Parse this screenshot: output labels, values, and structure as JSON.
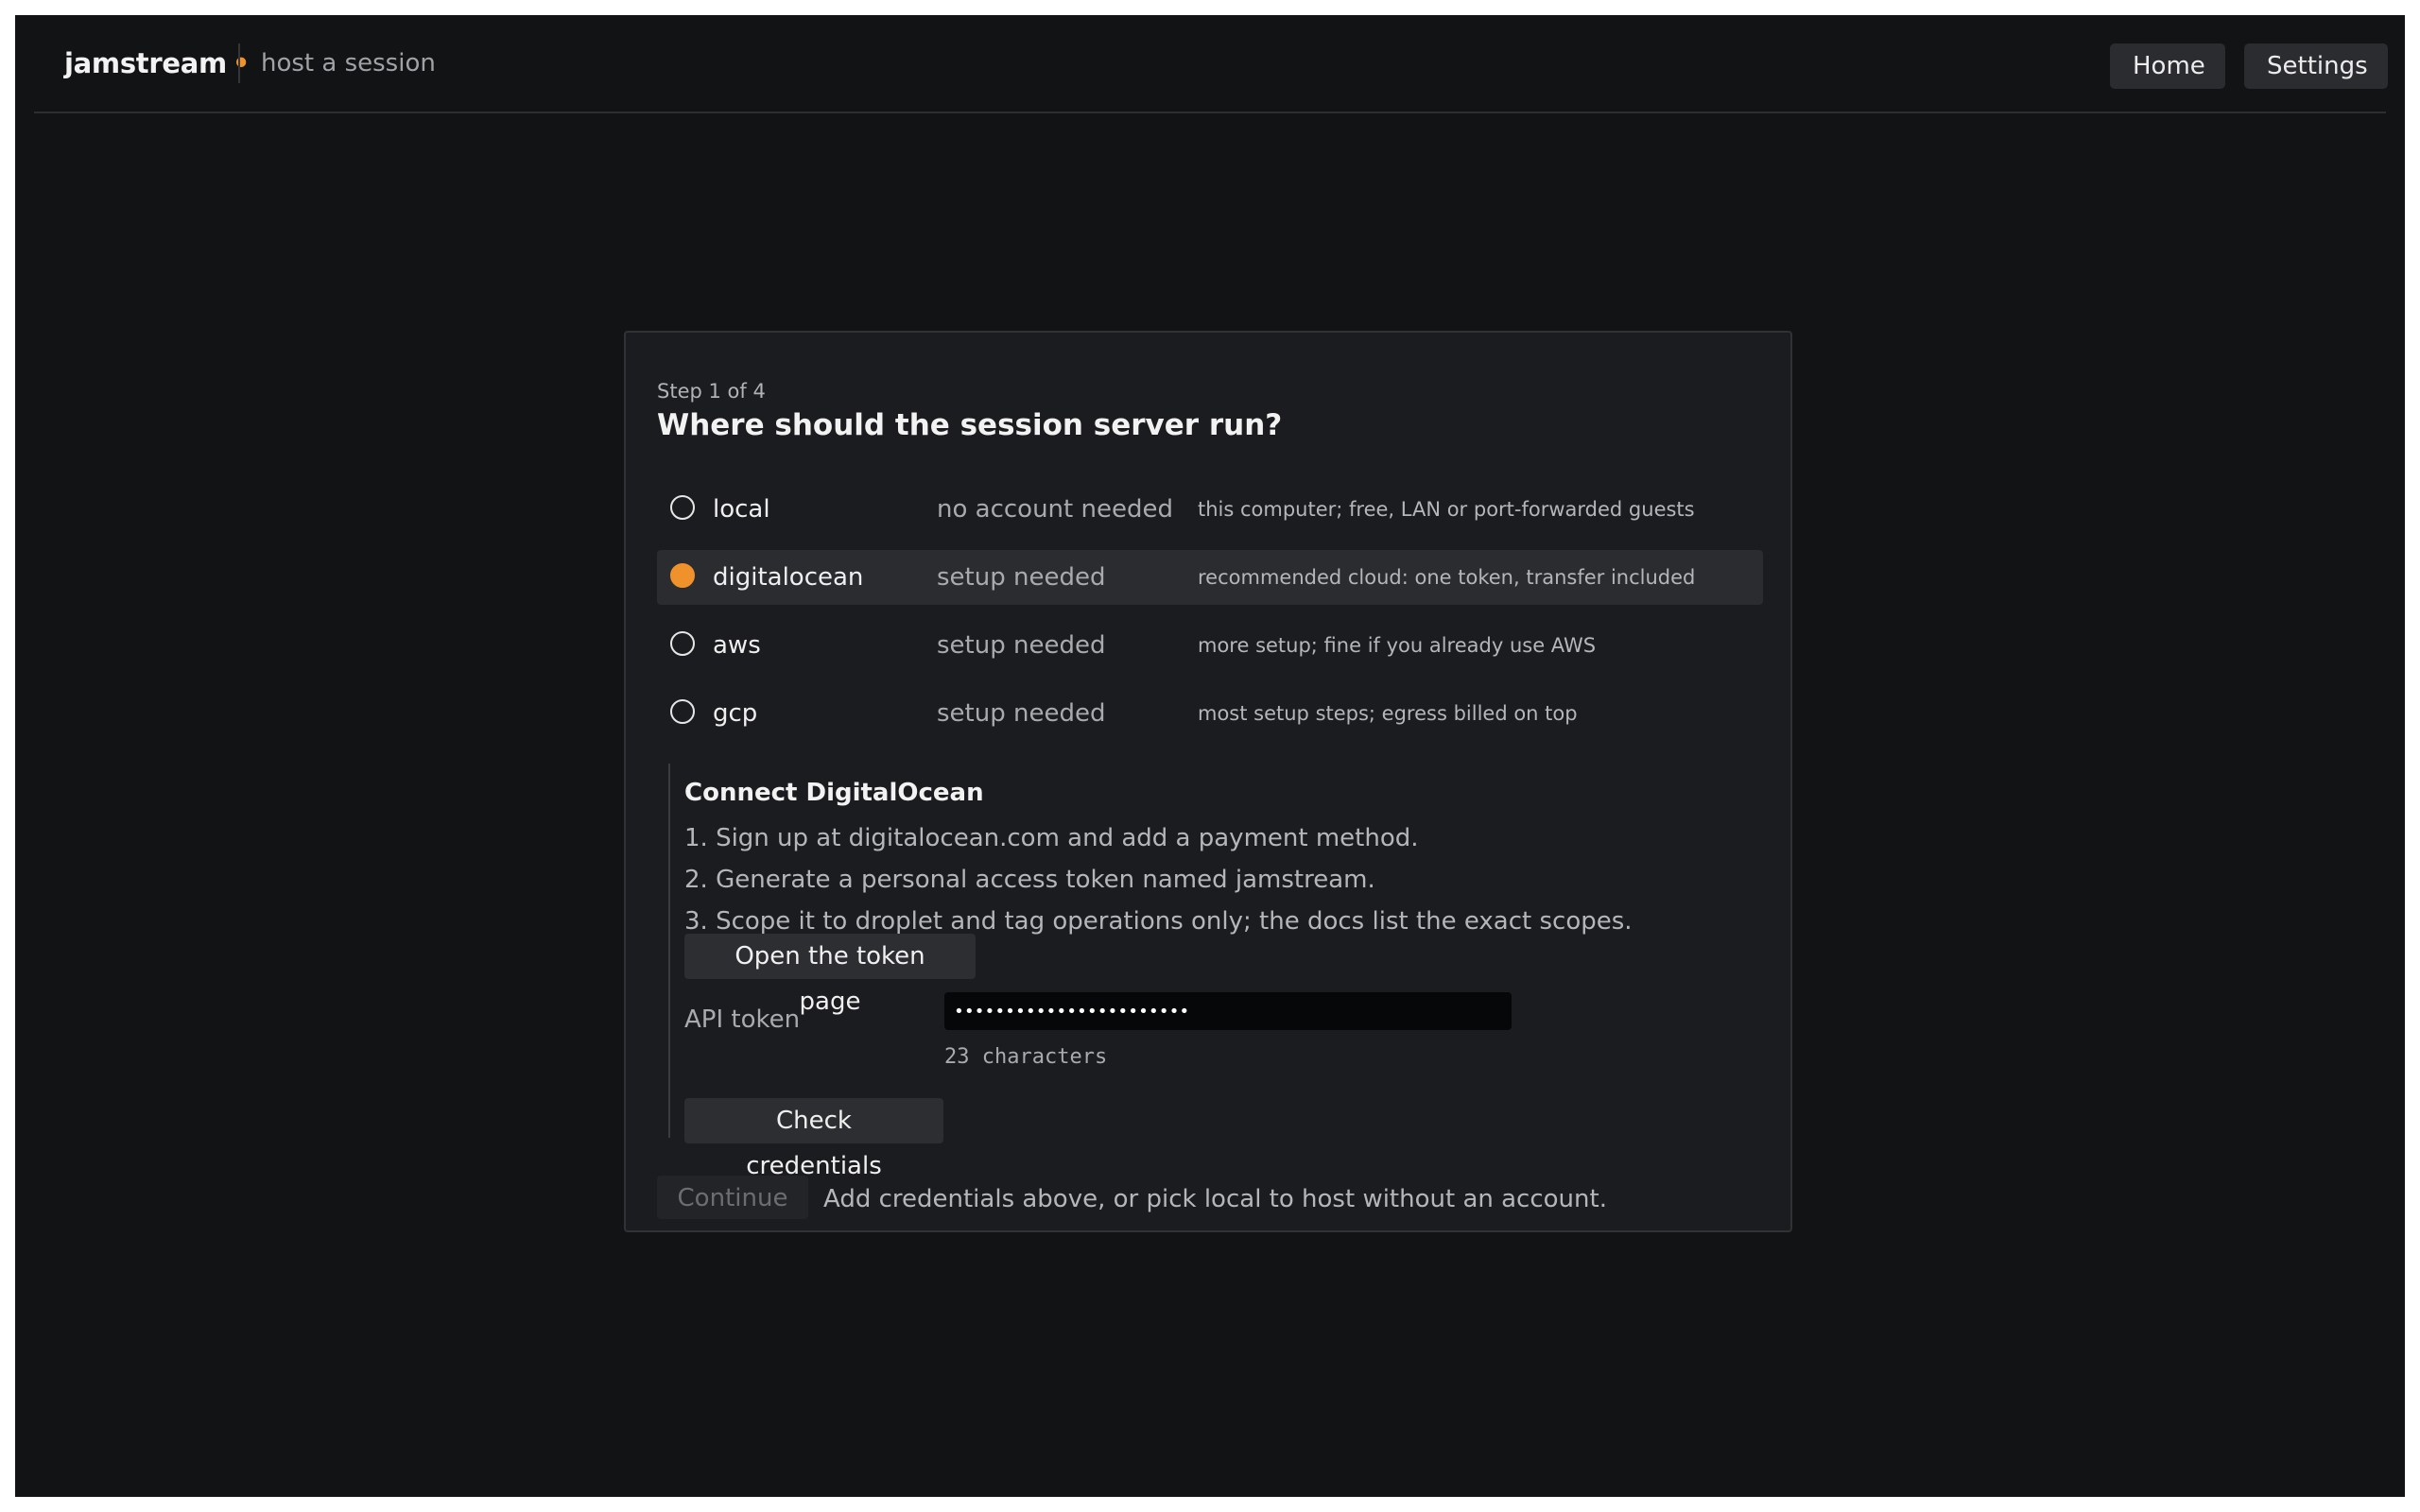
{
  "app": {
    "brand": "jamstream",
    "brand_dot": "•",
    "subtitle": "host a session"
  },
  "nav": {
    "home_label": "Home",
    "settings_label": "Settings"
  },
  "wizard": {
    "step": "Step 1 of 4",
    "heading": "Where should the session server run?",
    "selected": "digitalocean",
    "options": [
      {
        "name": "local",
        "status": "no account needed",
        "desc": "this computer; free, LAN or port-forwarded guests"
      },
      {
        "name": "digitalocean",
        "status": "setup needed",
        "desc": "recommended cloud: one token, transfer included"
      },
      {
        "name": "aws",
        "status": "setup needed",
        "desc": "more setup; fine if you already use AWS"
      },
      {
        "name": "gcp",
        "status": "setup needed",
        "desc": "most setup steps; egress billed on top"
      }
    ]
  },
  "connect": {
    "title": "Connect DigitalOcean",
    "steps": [
      "1. Sign up at digitalocean.com and add a payment method.",
      "2. Generate a personal access token named jamstream.",
      "3. Scope it to droplet and tag operations only; the docs list the exact scopes."
    ],
    "open_token_label": "Open the token page",
    "api_label": "API token",
    "api_value": "•••••••••••••••••••••••",
    "char_count": "23 characters",
    "check_label": "Check credentials"
  },
  "footer": {
    "continue_label": "Continue",
    "hint": "Add credentials above, or pick local to host without an account."
  },
  "colors": {
    "accent": "#f0922c",
    "background": "#121315",
    "card": "#1b1c1f"
  }
}
